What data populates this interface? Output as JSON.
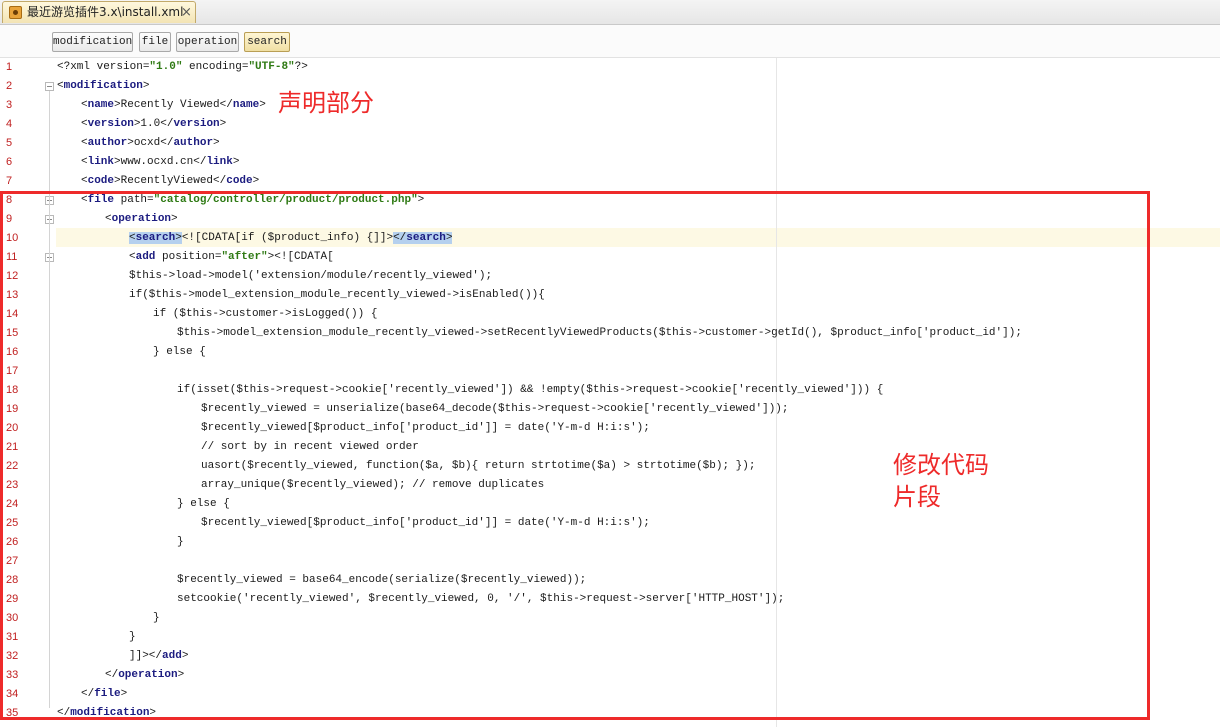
{
  "tab": {
    "title": "最近游览插件3.x\\install.xml",
    "close": "×"
  },
  "toolbar": {
    "buttons": [
      {
        "label": "modification",
        "selected": false
      },
      {
        "label": "file",
        "selected": false
      },
      {
        "label": "operation",
        "selected": false
      },
      {
        "label": "search",
        "selected": true
      }
    ]
  },
  "editor": {
    "current_line": 10,
    "lines": [
      {
        "n": "1",
        "indent": 0,
        "tokens": [
          [
            "t",
            "<?xml version="
          ],
          [
            "s",
            "\"1.0\""
          ],
          [
            "t",
            " encoding="
          ],
          [
            "s",
            "\"UTF-8\""
          ],
          [
            "t",
            "?>"
          ]
        ]
      },
      {
        "n": "2",
        "indent": 0,
        "tokens": [
          [
            "t",
            "<"
          ],
          [
            "k",
            "modification"
          ],
          [
            "t",
            ">"
          ]
        ]
      },
      {
        "n": "3",
        "indent": 1,
        "tokens": [
          [
            "t",
            "<"
          ],
          [
            "k",
            "name"
          ],
          [
            "t",
            ">Recently Viewed</"
          ],
          [
            "k",
            "name"
          ],
          [
            "t",
            ">"
          ]
        ]
      },
      {
        "n": "4",
        "indent": 1,
        "tokens": [
          [
            "t",
            "<"
          ],
          [
            "k",
            "version"
          ],
          [
            "t",
            ">1.0</"
          ],
          [
            "k",
            "version"
          ],
          [
            "t",
            ">"
          ]
        ]
      },
      {
        "n": "5",
        "indent": 1,
        "tokens": [
          [
            "t",
            "<"
          ],
          [
            "k",
            "author"
          ],
          [
            "t",
            ">ocxd</"
          ],
          [
            "k",
            "author"
          ],
          [
            "t",
            ">"
          ]
        ]
      },
      {
        "n": "6",
        "indent": 1,
        "tokens": [
          [
            "t",
            "<"
          ],
          [
            "k",
            "link"
          ],
          [
            "t",
            ">www.ocxd.cn</"
          ],
          [
            "k",
            "link"
          ],
          [
            "t",
            ">"
          ]
        ]
      },
      {
        "n": "7",
        "indent": 1,
        "tokens": [
          [
            "t",
            "<"
          ],
          [
            "k",
            "code"
          ],
          [
            "t",
            ">RecentlyViewed</"
          ],
          [
            "k",
            "code"
          ],
          [
            "t",
            ">"
          ]
        ]
      },
      {
        "n": "8",
        "indent": 1,
        "tokens": [
          [
            "t",
            "<"
          ],
          [
            "k",
            "file"
          ],
          [
            "t",
            " path="
          ],
          [
            "s",
            "\"catalog/controller/product/product.php\""
          ],
          [
            "t",
            ">"
          ]
        ]
      },
      {
        "n": "9",
        "indent": 2,
        "tokens": [
          [
            "t",
            "<"
          ],
          [
            "k",
            "operation"
          ],
          [
            "t",
            ">"
          ]
        ]
      },
      {
        "n": "10",
        "indent": 3,
        "tokens": [
          [
            "h",
            "<"
          ],
          [
            "hk",
            "search"
          ],
          [
            "h",
            ">"
          ],
          [
            "t",
            "<![CDATA[if ($product_info) {]]>"
          ],
          [
            "h",
            "</"
          ],
          [
            "hk",
            "search"
          ],
          [
            "h",
            ">"
          ]
        ]
      },
      {
        "n": "11",
        "indent": 3,
        "tokens": [
          [
            "t",
            "<"
          ],
          [
            "k",
            "add"
          ],
          [
            "t",
            " position="
          ],
          [
            "s",
            "\"after\""
          ],
          [
            "t",
            "><![CDATA["
          ]
        ]
      },
      {
        "n": "12",
        "indent": 3,
        "tokens": [
          [
            "t",
            "$this->load->model('extension/module/recently_viewed');"
          ]
        ]
      },
      {
        "n": "13",
        "indent": 3,
        "tokens": [
          [
            "t",
            "if($this->model_extension_module_recently_viewed->isEnabled()){"
          ]
        ]
      },
      {
        "n": "14",
        "indent": 4,
        "tokens": [
          [
            "t",
            "if ($this->customer->isLogged()) {"
          ]
        ]
      },
      {
        "n": "15",
        "indent": 5,
        "tokens": [
          [
            "t",
            "$this->model_extension_module_recently_viewed->setRecentlyViewedProducts($this->customer->getId(), $product_info['product_id']);"
          ]
        ]
      },
      {
        "n": "16",
        "indent": 4,
        "tokens": [
          [
            "t",
            "} else {"
          ]
        ]
      },
      {
        "n": "17",
        "indent": 0,
        "tokens": []
      },
      {
        "n": "18",
        "indent": 5,
        "tokens": [
          [
            "t",
            "if(isset($this->request->cookie['recently_viewed']) && !empty($this->request->cookie['recently_viewed'])) {"
          ]
        ]
      },
      {
        "n": "19",
        "indent": 6,
        "tokens": [
          [
            "t",
            "$recently_viewed = unserialize(base64_decode($this->request->cookie['recently_viewed']));"
          ]
        ]
      },
      {
        "n": "20",
        "indent": 6,
        "tokens": [
          [
            "t",
            "$recently_viewed[$product_info['product_id']] = date('Y-m-d H:i:s');"
          ]
        ]
      },
      {
        "n": "21",
        "indent": 6,
        "tokens": [
          [
            "t",
            "// sort by in recent viewed order"
          ]
        ]
      },
      {
        "n": "22",
        "indent": 6,
        "tokens": [
          [
            "t",
            "uasort($recently_viewed, function($a, $b){ return strtotime($a) > strtotime($b); });"
          ]
        ]
      },
      {
        "n": "23",
        "indent": 6,
        "tokens": [
          [
            "t",
            "array_unique($recently_viewed); // remove duplicates"
          ]
        ]
      },
      {
        "n": "24",
        "indent": 5,
        "tokens": [
          [
            "t",
            "} else {"
          ]
        ]
      },
      {
        "n": "25",
        "indent": 6,
        "tokens": [
          [
            "t",
            "$recently_viewed[$product_info['product_id']] = date('Y-m-d H:i:s');"
          ]
        ]
      },
      {
        "n": "26",
        "indent": 5,
        "tokens": [
          [
            "t",
            "}"
          ]
        ]
      },
      {
        "n": "27",
        "indent": 0,
        "tokens": []
      },
      {
        "n": "28",
        "indent": 5,
        "tokens": [
          [
            "t",
            "$recently_viewed = base64_encode(serialize($recently_viewed));"
          ]
        ]
      },
      {
        "n": "29",
        "indent": 5,
        "tokens": [
          [
            "t",
            "setcookie('recently_viewed', $recently_viewed, 0, '/', $this->request->server['HTTP_HOST']);"
          ]
        ]
      },
      {
        "n": "30",
        "indent": 4,
        "tokens": [
          [
            "t",
            "}"
          ]
        ]
      },
      {
        "n": "31",
        "indent": 3,
        "tokens": [
          [
            "t",
            "}"
          ]
        ]
      },
      {
        "n": "32",
        "indent": 3,
        "tokens": [
          [
            "t",
            "]]></"
          ],
          [
            "k",
            "add"
          ],
          [
            "t",
            ">"
          ]
        ]
      },
      {
        "n": "33",
        "indent": 2,
        "tokens": [
          [
            "t",
            "</"
          ],
          [
            "k",
            "operation"
          ],
          [
            "t",
            ">"
          ]
        ]
      },
      {
        "n": "34",
        "indent": 1,
        "tokens": [
          [
            "t",
            "</"
          ],
          [
            "k",
            "file"
          ],
          [
            "t",
            ">"
          ]
        ]
      },
      {
        "n": "35",
        "indent": 0,
        "tokens": [
          [
            "t",
            "</"
          ],
          [
            "k",
            "modification"
          ],
          [
            "t",
            ">"
          ]
        ]
      }
    ]
  },
  "annotations": {
    "declaration_note": "声明部分",
    "modification_note_line1": "修改代码",
    "modification_note_line2": "片段"
  },
  "colors": {
    "line_number": "#c02020",
    "annotation": "#ee2a2a",
    "tag": "#1c1c80",
    "string": "#2f7a14",
    "selection": "#b5d0ee"
  }
}
